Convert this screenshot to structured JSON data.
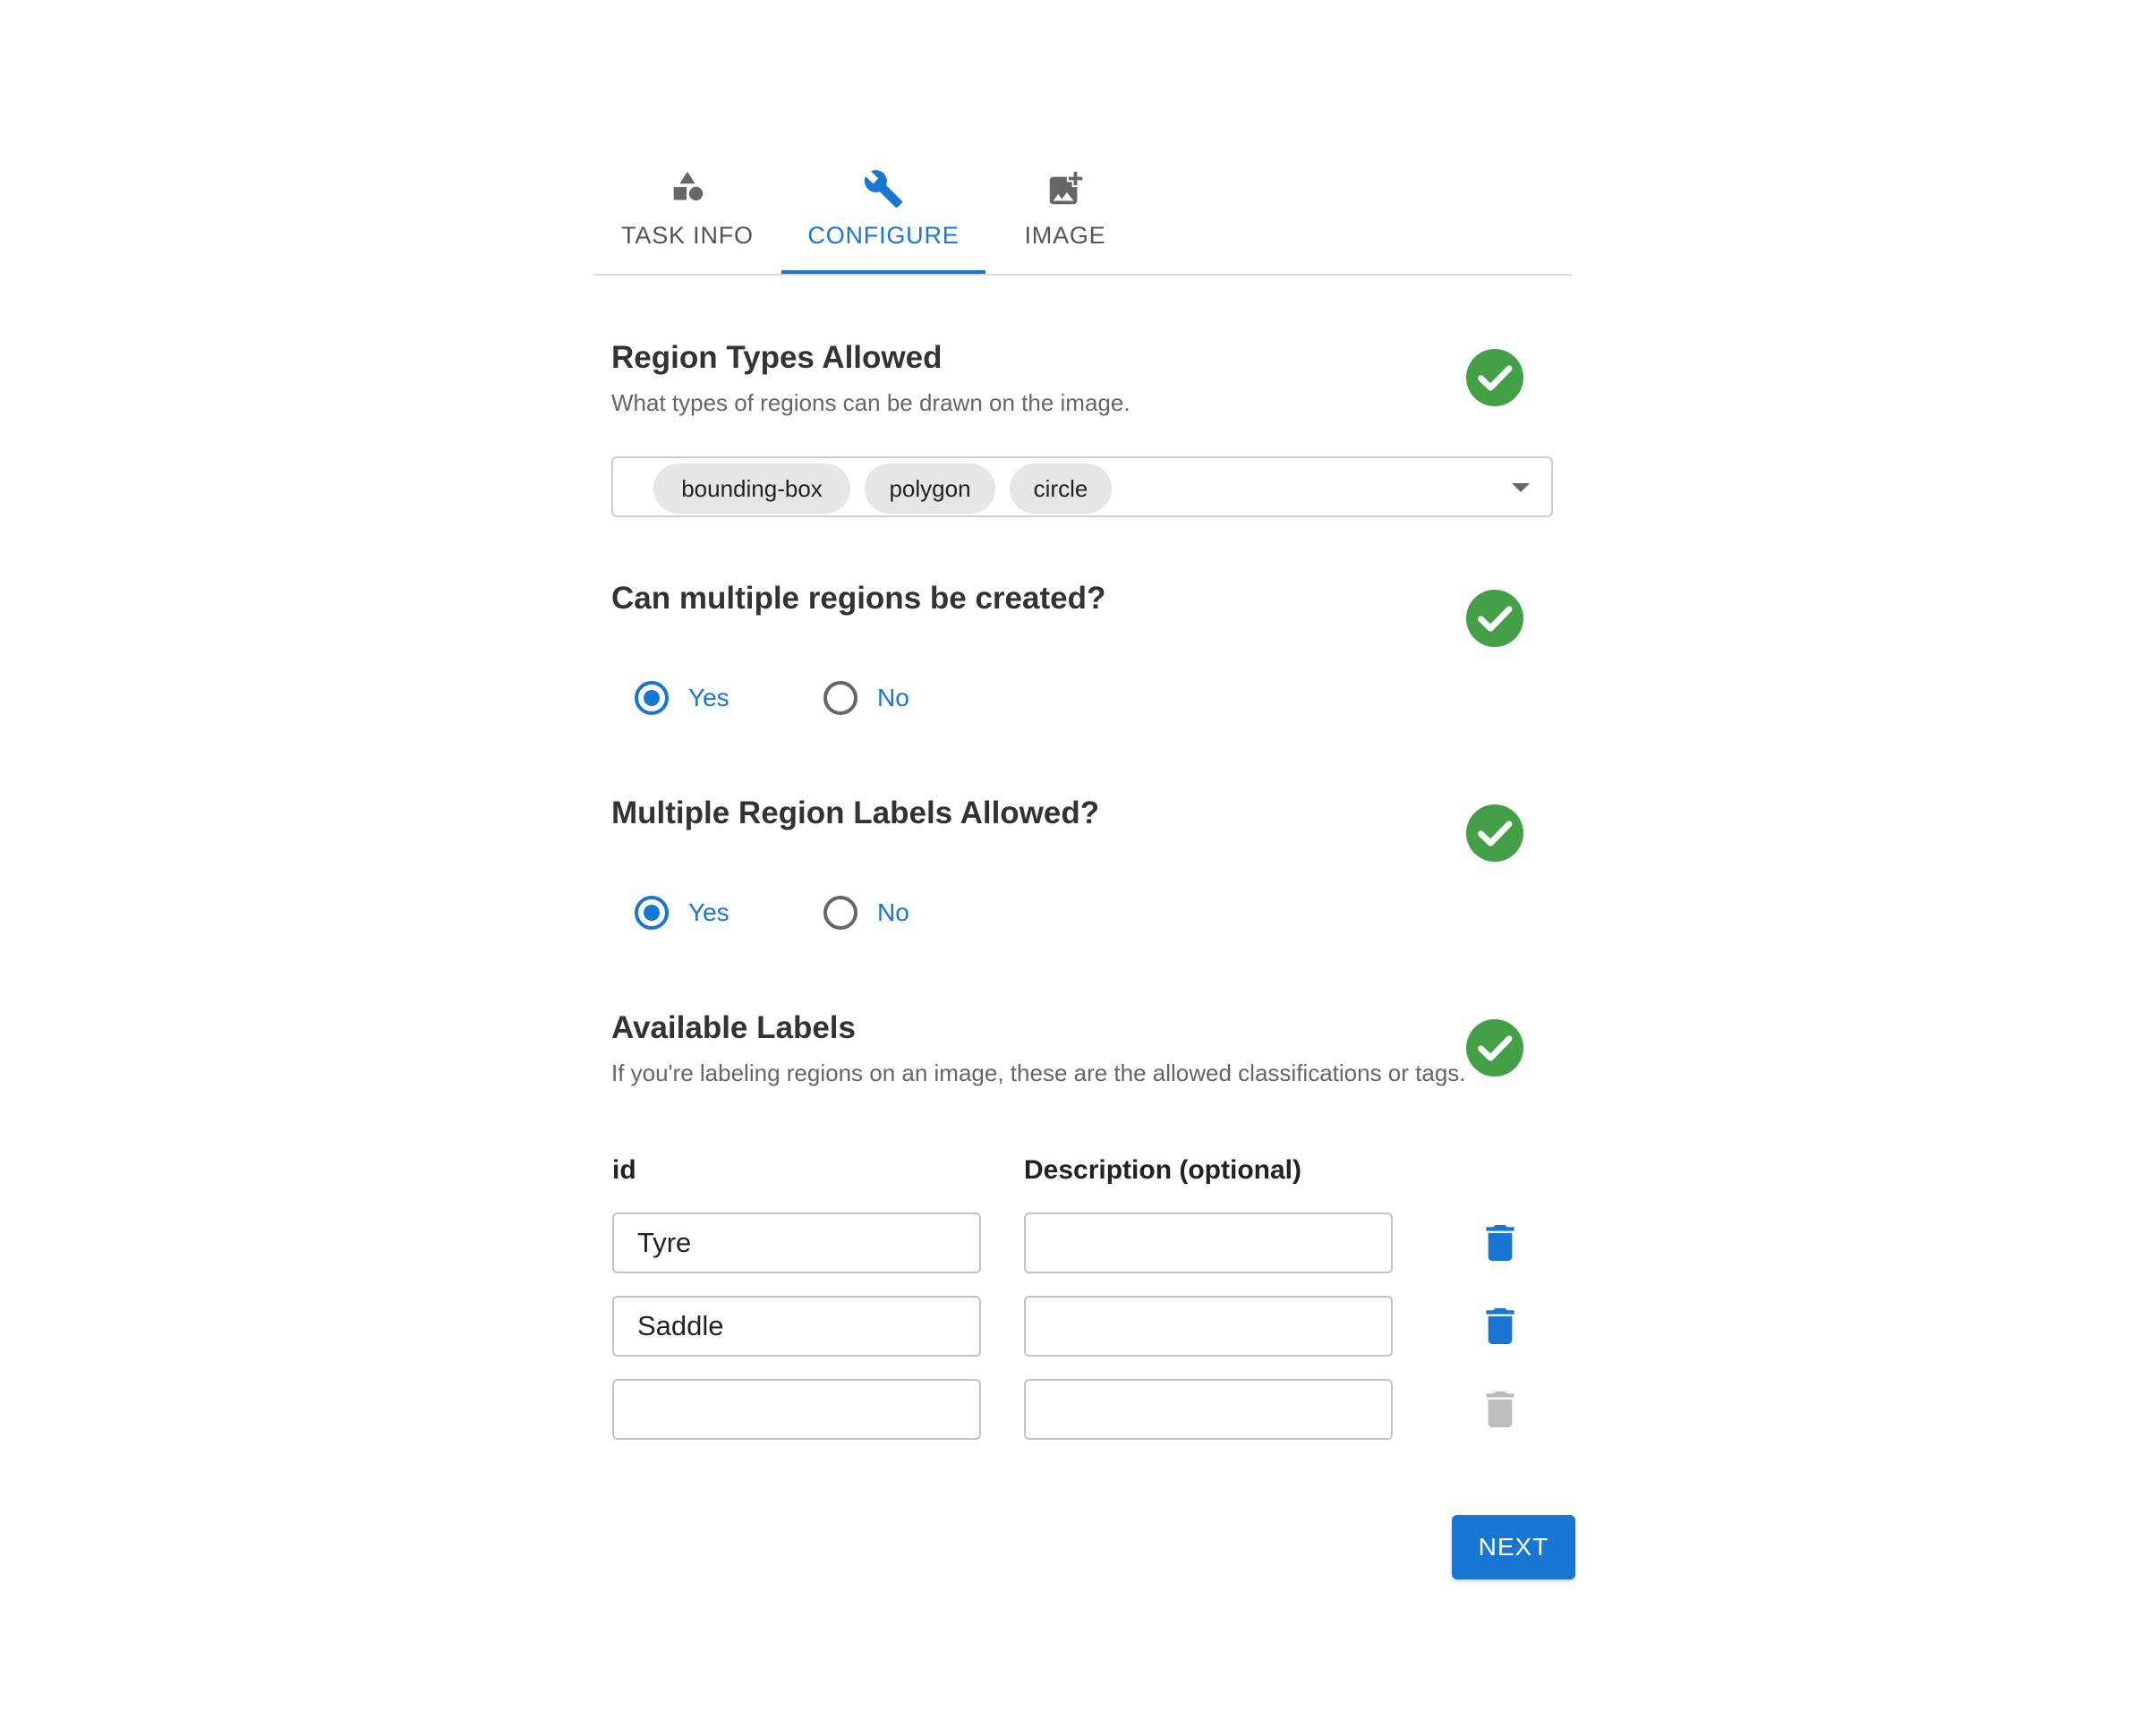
{
  "tabs": [
    {
      "label": "TASK INFO",
      "icon": "shapes-icon",
      "active": false
    },
    {
      "label": "CONFIGURE",
      "icon": "wrench-icon",
      "active": true
    },
    {
      "label": "IMAGE",
      "icon": "add-photo-icon",
      "active": false
    }
  ],
  "region_types": {
    "title": "Region Types Allowed",
    "description": "What types of regions can be drawn on the image.",
    "selected": [
      "bounding-box",
      "polygon",
      "circle"
    ]
  },
  "multiple_regions": {
    "title": "Can multiple regions be created?",
    "options": [
      "Yes",
      "No"
    ],
    "selected": "Yes"
  },
  "multiple_labels": {
    "title": "Multiple Region Labels Allowed?",
    "options": [
      "Yes",
      "No"
    ],
    "selected": "Yes"
  },
  "available_labels": {
    "title": "Available Labels",
    "description": "If you're labeling regions on an image, these are the allowed classifications or tags.",
    "columns": [
      "id",
      "Description (optional)"
    ],
    "rows": [
      {
        "id": "Tyre",
        "description": ""
      },
      {
        "id": "Saddle",
        "description": ""
      },
      {
        "id": "",
        "description": ""
      }
    ]
  },
  "next_label": "NEXT",
  "colors": {
    "primary": "#1976d2",
    "success": "#43a047",
    "disabled": "#bdbdbd"
  }
}
